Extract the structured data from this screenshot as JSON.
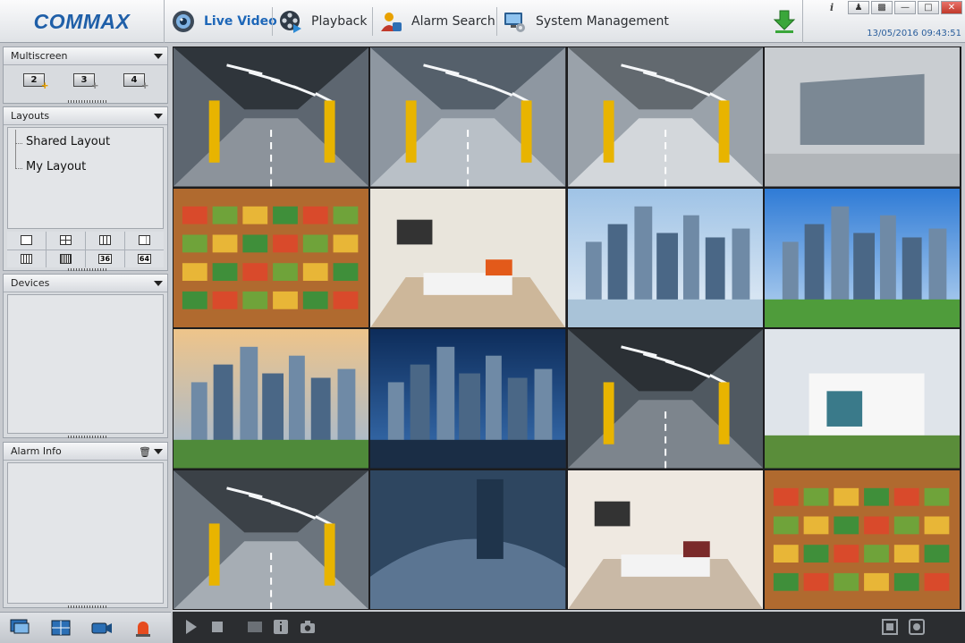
{
  "app": {
    "logo": "COMMAX",
    "datetime": "13/05/2016 09:43:51"
  },
  "nav": {
    "live_video": "Live Video",
    "playback": "Playback",
    "alarm_search": "Alarm Search",
    "system_management": "System Management"
  },
  "icons": {
    "live": "camera-eye-icon",
    "playback": "film-reel-icon",
    "alarm": "alarm-person-icon",
    "system": "monitor-gear-icon",
    "download": "download-arrow-icon"
  },
  "sidebar": {
    "multiscreen": {
      "title": "Multiscreen",
      "buttons": [
        "2",
        "3",
        "4"
      ]
    },
    "layouts": {
      "title": "Layouts",
      "items": [
        "Shared Layout",
        "My Layout"
      ],
      "splits": [
        "",
        "",
        "",
        "",
        "",
        "",
        "36",
        "64"
      ]
    },
    "devices": {
      "title": "Devices"
    },
    "alarm_info": {
      "title": "Alarm Info"
    }
  },
  "colors": {
    "accent": "#1e67b8",
    "logo": "#1f5fa8",
    "alarm": "#e8a100"
  },
  "tiles": [
    "parking-garage-1",
    "parking-garage-2",
    "parking-garage-3",
    "atrium-plaza",
    "supermarket-aisles",
    "living-room",
    "city-skyline-1",
    "city-skyline-2",
    "city-park-skyline",
    "skyscraper-night",
    "parking-garage-4",
    "modern-house",
    "parking-garage-5",
    "highway-interchange",
    "lounge-room",
    "fruit-market"
  ]
}
